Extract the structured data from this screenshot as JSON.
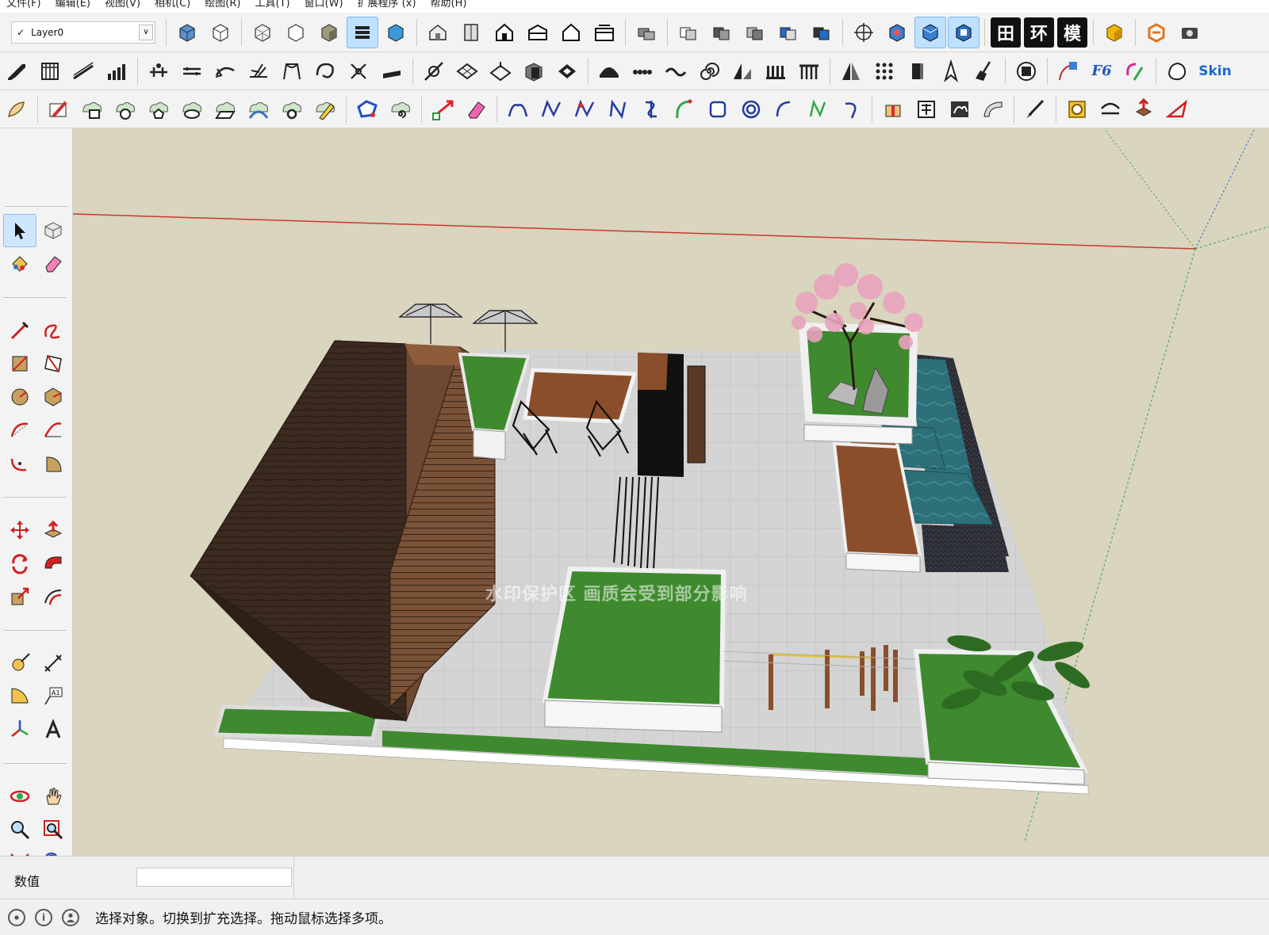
{
  "menu": [
    "文件(F)",
    "编辑(E)",
    "视图(V)",
    "相机(C)",
    "绘图(R)",
    "工具(T)",
    "窗口(W)",
    "扩展程序 (x)",
    "帮助(H)"
  ],
  "layer": {
    "checkmark": "✓",
    "name": "Layer0",
    "chevron": "∨"
  },
  "toolbar": {
    "text_buttons": {
      "grid": "田",
      "huan": "环",
      "mo": "模",
      "f6": "F6",
      "skin": "Skin"
    }
  },
  "viewport": {
    "watermark": "水印保护区  画质会受到部分影响"
  },
  "measurements": {
    "label": "数值",
    "value": ""
  },
  "status": {
    "message": "选择对象。切换到扩充选择。拖动鼠标选择多项。",
    "info_glyph": "i"
  },
  "colors": {
    "canvas": "#d9d5be",
    "grass": "#3f8a2f",
    "paving": "#d3d3d3",
    "wood_dark": "#3a2a1f",
    "wood_mid": "#6b4a32",
    "wood_light": "#8a4f2a",
    "water": "#2c6f78",
    "blossom": "#e9a3bd",
    "axis_red": "#c83a32",
    "axis_green": "#3aa045",
    "active_tool": "#bfe0ff"
  }
}
